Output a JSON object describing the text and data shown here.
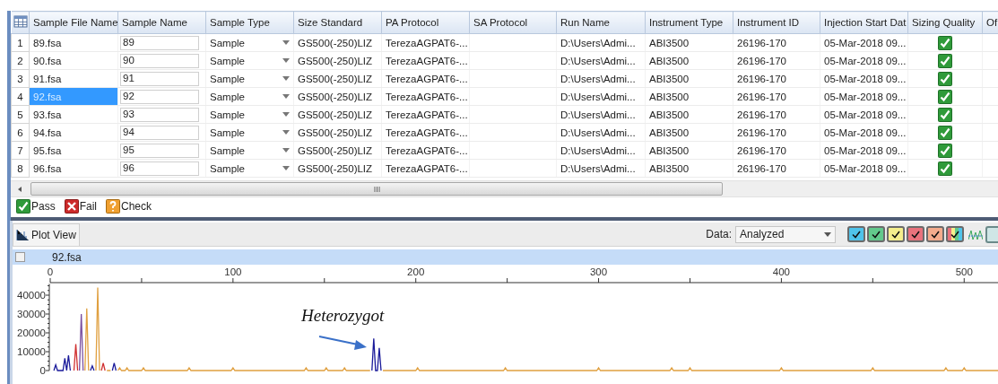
{
  "table": {
    "columns": [
      "Sample File Name",
      "Sample Name",
      "Sample Type",
      "Size Standard",
      "PA Protocol",
      "SA Protocol",
      "Run Name",
      "Instrument Type",
      "Instrument ID",
      "Injection Start Dat",
      "Sizing Quality",
      "Of"
    ],
    "rows": [
      {
        "number": "1",
        "file_name": "89.fsa",
        "selected": false,
        "sample_name": "89",
        "sample_type": "Sample",
        "size_standard": "GS500(-250)LIZ",
        "pa_protocol": "TerezaAGPAT6-...",
        "run_name": "D:\\Users\\Admi...",
        "instrument_type": "ABI3500",
        "instrument_id": "26196-170",
        "injection_start": "05-Mar-2018 09...",
        "sizing_quality": {
          "kind": "pass"
        }
      },
      {
        "number": "2",
        "file_name": "90.fsa",
        "selected": false,
        "sample_name": "90",
        "sample_type": "Sample",
        "size_standard": "GS500(-250)LIZ",
        "pa_protocol": "TerezaAGPAT6-...",
        "run_name": "D:\\Users\\Admi...",
        "instrument_type": "ABI3500",
        "instrument_id": "26196-170",
        "injection_start": "05-Mar-2018 09...",
        "sizing_quality": {
          "kind": "pass"
        }
      },
      {
        "number": "3",
        "file_name": "91.fsa",
        "selected": false,
        "sample_name": "91",
        "sample_type": "Sample",
        "size_standard": "GS500(-250)LIZ",
        "pa_protocol": "TerezaAGPAT6-...",
        "run_name": "D:\\Users\\Admi...",
        "instrument_type": "ABI3500",
        "instrument_id": "26196-170",
        "injection_start": "05-Mar-2018 09...",
        "sizing_quality": {
          "kind": "pass"
        }
      },
      {
        "number": "4",
        "file_name": "92.fsa",
        "selected": true,
        "sample_name": "92",
        "sample_type": "Sample",
        "size_standard": "GS500(-250)LIZ",
        "pa_protocol": "TerezaAGPAT6-...",
        "run_name": "D:\\Users\\Admi...",
        "instrument_type": "ABI3500",
        "instrument_id": "26196-170",
        "injection_start": "05-Mar-2018 09...",
        "sizing_quality": {
          "kind": "pass"
        }
      },
      {
        "number": "5",
        "file_name": "93.fsa",
        "selected": false,
        "sample_name": "93",
        "sample_type": "Sample",
        "size_standard": "GS500(-250)LIZ",
        "pa_protocol": "TerezaAGPAT6-...",
        "run_name": "D:\\Users\\Admi...",
        "instrument_type": "ABI3500",
        "instrument_id": "26196-170",
        "injection_start": "05-Mar-2018 09...",
        "sizing_quality": {
          "kind": "pass"
        }
      },
      {
        "number": "6",
        "file_name": "94.fsa",
        "selected": false,
        "sample_name": "94",
        "sample_type": "Sample",
        "size_standard": "GS500(-250)LIZ",
        "pa_protocol": "TerezaAGPAT6-...",
        "run_name": "D:\\Users\\Admi...",
        "instrument_type": "ABI3500",
        "instrument_id": "26196-170",
        "injection_start": "05-Mar-2018 09...",
        "sizing_quality": {
          "kind": "pass"
        }
      },
      {
        "number": "7",
        "file_name": "95.fsa",
        "selected": false,
        "sample_name": "95",
        "sample_type": "Sample",
        "size_standard": "GS500(-250)LIZ",
        "pa_protocol": "TerezaAGPAT6-...",
        "run_name": "D:\\Users\\Admi...",
        "instrument_type": "ABI3500",
        "instrument_id": "26196-170",
        "injection_start": "05-Mar-2018 09...",
        "sizing_quality": {
          "kind": "pass"
        }
      },
      {
        "number": "8",
        "file_name": "96.fsa",
        "selected": false,
        "sample_name": "96",
        "sample_type": "Sample",
        "size_standard": "GS500(-250)LIZ",
        "pa_protocol": "TerezaAGPAT6-...",
        "run_name": "D:\\Users\\Admi...",
        "instrument_type": "ABI3500",
        "instrument_id": "26196-170",
        "injection_start": "05-Mar-2018 09...",
        "sizing_quality": {
          "kind": "pass"
        }
      }
    ]
  },
  "legend": [
    {
      "kind": "pass",
      "label": "Pass"
    },
    {
      "kind": "fail",
      "label": "Fail"
    },
    {
      "kind": "check",
      "label": "Check"
    }
  ],
  "plot_view": {
    "tab": {
      "label": "Plot View",
      "selected": true
    },
    "data_label": "Data:",
    "data_value": "Analyzed",
    "dye_buttons": [
      {
        "kind": "single",
        "color": "#4fc3ea",
        "checked": true
      },
      {
        "kind": "single",
        "color": "#62c98c",
        "checked": true
      },
      {
        "kind": "single",
        "color": "#f4ee8c",
        "checked": true
      },
      {
        "kind": "single",
        "color": "#e9727c",
        "checked": true
      },
      {
        "kind": "single",
        "color": "#f4ab8c",
        "checked": true
      },
      {
        "kind": "multi",
        "checked": true
      }
    ],
    "sample": {
      "name": "92.fsa",
      "checked": false
    },
    "chart_data": {
      "type": "line",
      "x": [
        2,
        3,
        4,
        7,
        8,
        9,
        10,
        11,
        13,
        14,
        15,
        16,
        17,
        18,
        19,
        20,
        21,
        22,
        23,
        24,
        25,
        26,
        27,
        28,
        29,
        30,
        31,
        33,
        34,
        35,
        36,
        37,
        38,
        39,
        41,
        42,
        43,
        50,
        51,
        52,
        75,
        76,
        77,
        99,
        100,
        101,
        139,
        140,
        141,
        150,
        151,
        152,
        160,
        161,
        162,
        175,
        176,
        177,
        178,
        179,
        180,
        181,
        182,
        200,
        201,
        202,
        248,
        249,
        250,
        299,
        300,
        301,
        339,
        340,
        341,
        349,
        350,
        351,
        399,
        400,
        401,
        449,
        450,
        451,
        489,
        490,
        491,
        499,
        500,
        501,
        519
      ],
      "series": [
        {
          "color": "#e0a040",
          "values": [
            null,
            null,
            null,
            null,
            null,
            null,
            null,
            null,
            null,
            null,
            null,
            null,
            null,
            null,
            0,
            33000,
            0,
            null,
            null,
            null,
            0,
            44000,
            0,
            null,
            null,
            null,
            0,
            0,
            null,
            null,
            null,
            0,
            1500,
            0,
            0,
            1500,
            0,
            0,
            1500,
            0,
            0,
            1500,
            0,
            0,
            1500,
            0,
            0,
            1500,
            0,
            0,
            1500,
            0,
            0,
            1500,
            0,
            0,
            null,
            null,
            null,
            null,
            null,
            null,
            0,
            0,
            1500,
            0,
            0,
            1500,
            0,
            0,
            1500,
            0,
            0,
            1500,
            0,
            0,
            1500,
            0,
            0,
            1500,
            0,
            0,
            1500,
            0,
            0,
            1500,
            0,
            0,
            1500,
            0,
            0
          ]
        },
        {
          "color": "#7a4fa0",
          "values": [
            null,
            null,
            null,
            null,
            null,
            null,
            null,
            null,
            null,
            null,
            null,
            0,
            30000,
            0,
            null,
            null,
            null,
            null,
            null,
            null,
            null,
            null,
            null,
            null,
            null,
            null,
            null,
            null,
            null,
            null,
            null,
            null,
            null,
            null,
            null,
            null,
            null,
            null,
            null,
            null,
            null,
            null,
            null,
            null,
            null,
            null,
            null,
            null,
            null,
            null,
            null,
            null,
            null,
            null,
            null,
            null,
            null,
            null,
            null,
            null,
            null,
            null,
            null,
            null,
            null,
            null,
            null,
            null,
            null,
            null,
            null,
            null,
            null,
            null,
            null,
            null,
            null,
            null,
            null,
            null,
            null,
            null,
            null,
            null,
            null,
            null,
            null,
            null,
            null,
            null,
            null
          ]
        },
        {
          "color": "#d03030",
          "values": [
            null,
            null,
            null,
            null,
            null,
            null,
            null,
            null,
            0,
            14000,
            0,
            null,
            null,
            null,
            null,
            null,
            null,
            null,
            null,
            null,
            null,
            null,
            null,
            0,
            4000,
            0,
            null,
            null,
            null,
            null,
            null,
            null,
            null,
            null,
            null,
            null,
            null,
            null,
            null,
            null,
            null,
            null,
            null,
            null,
            null,
            null,
            null,
            null,
            null,
            null,
            null,
            null,
            null,
            null,
            null,
            null,
            null,
            null,
            null,
            null,
            null,
            null,
            null,
            null,
            null,
            null,
            null,
            null,
            null,
            null,
            null,
            null,
            null,
            null,
            null,
            null,
            null,
            null,
            null,
            null,
            null,
            null,
            null,
            null,
            null,
            null,
            null,
            null,
            null,
            null,
            null
          ]
        },
        {
          "color": "#1a1a9a",
          "values": [
            0,
            3000,
            0,
            0,
            6500,
            0,
            8000,
            0,
            null,
            null,
            null,
            null,
            null,
            null,
            null,
            null,
            null,
            0,
            2500,
            0,
            null,
            null,
            null,
            null,
            null,
            null,
            null,
            null,
            0,
            4000,
            0,
            null,
            null,
            null,
            null,
            null,
            null,
            null,
            null,
            null,
            null,
            null,
            null,
            null,
            null,
            null,
            null,
            null,
            null,
            null,
            null,
            null,
            null,
            null,
            null,
            null,
            0,
            17000,
            0,
            0,
            12000,
            0,
            null,
            null,
            null,
            null,
            null,
            null,
            null,
            null,
            null,
            null,
            null,
            null,
            null,
            null,
            null,
            null,
            null,
            null,
            null,
            null,
            null,
            null,
            null,
            null,
            null,
            null,
            null,
            null,
            null
          ]
        }
      ],
      "xlim": [
        0,
        519
      ],
      "ylim": [
        0,
        46000
      ],
      "xticks": [
        0,
        100,
        200,
        300,
        400,
        500
      ],
      "yticks": [
        0,
        10000,
        20000,
        30000,
        40000
      ],
      "annotations": [
        {
          "text": "Heterozygot"
        }
      ]
    }
  }
}
